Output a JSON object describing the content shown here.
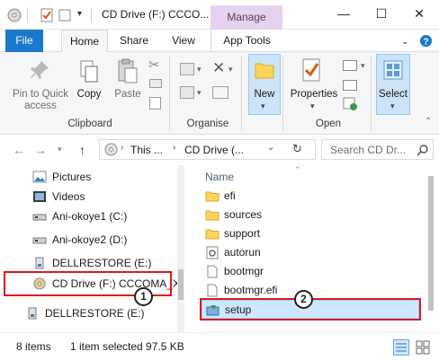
{
  "window": {
    "title": "CD Drive (F:) CCCO...",
    "manage_label": "Manage",
    "minimize": "—",
    "maximize": "☐",
    "close": "✕"
  },
  "ribbon_tabs": [
    {
      "label": "File"
    },
    {
      "label": "Home"
    },
    {
      "label": "Share"
    },
    {
      "label": "View"
    },
    {
      "label": "App Tools"
    }
  ],
  "ribbon": {
    "pin_to_quick_access": "Pin to Quick access",
    "copy": "Copy",
    "paste": "Paste",
    "clipboard": "Clipboard",
    "organise": "Organise",
    "new": "New",
    "properties": "Properties",
    "open": "Open",
    "select": "Select"
  },
  "address": {
    "segment_1": "This ...",
    "segment_2": "CD Drive (...",
    "search_placeholder": "Search CD Dr..."
  },
  "nav_items": [
    {
      "label": "Pictures",
      "icon": "pictures-folder-icon"
    },
    {
      "label": "Videos",
      "icon": "videos-folder-icon"
    },
    {
      "label": "Ani-okoye1 (C:)",
      "icon": "drive-icon"
    },
    {
      "label": "Ani-okoye2 (D:)",
      "icon": "drive-icon"
    },
    {
      "label": "DELLRESTORE (E:)",
      "icon": "usb-drive-icon"
    },
    {
      "label": "CD Drive (F:) CCCOMA_X",
      "icon": "cd-drive-icon"
    },
    {
      "label": "DELLRESTORE (E:)",
      "icon": "usb-drive-icon"
    }
  ],
  "content": {
    "column_name": "Name",
    "files": [
      {
        "name": "efi",
        "icon": "folder-icon"
      },
      {
        "name": "sources",
        "icon": "folder-icon"
      },
      {
        "name": "support",
        "icon": "folder-icon"
      },
      {
        "name": "autorun",
        "icon": "settings-file-icon"
      },
      {
        "name": "bootmgr",
        "icon": "file-icon"
      },
      {
        "name": "bootmgr.efi",
        "icon": "file-icon"
      },
      {
        "name": "setup",
        "icon": "setup-icon"
      }
    ],
    "selected_file": "setup"
  },
  "annotations": {
    "step_1": "1",
    "step_2": "2"
  },
  "status": {
    "item_count": "8 items",
    "selection": "1 item selected  97.5 KB"
  },
  "colors": {
    "accent": "#1979ca",
    "manage_bg": "#e6d2ee",
    "selection_bg": "#cce8ff",
    "callout_red": "#e0161e"
  }
}
